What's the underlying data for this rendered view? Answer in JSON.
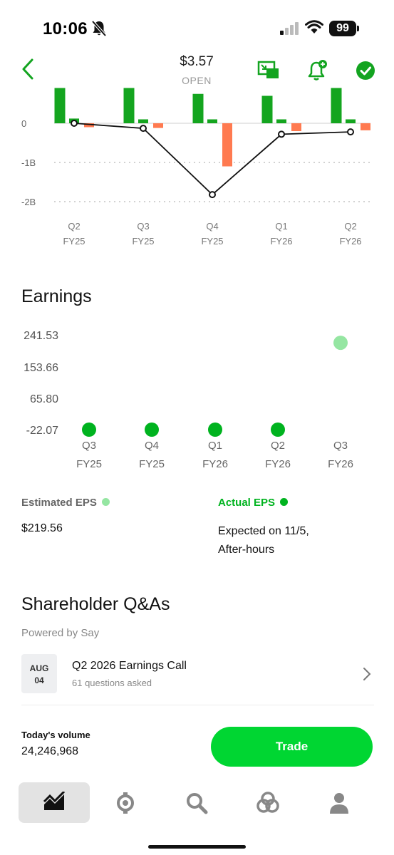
{
  "status_bar": {
    "time": "10:06",
    "battery": "99"
  },
  "header": {
    "price": "$3.57",
    "session": "OPEN",
    "icons": [
      "back-chevron-icon",
      "picture-in-picture-icon",
      "add-alert-bell-icon",
      "owned-check-icon"
    ]
  },
  "revenue_chart": {
    "y_labels": [
      "0",
      "-1B",
      "-2B"
    ],
    "quarters": [
      {
        "q": "Q2",
        "fy": "FY25"
      },
      {
        "q": "Q3",
        "fy": "FY25"
      },
      {
        "q": "Q4",
        "fy": "FY25"
      },
      {
        "q": "Q1",
        "fy": "FY26"
      },
      {
        "q": "Q2",
        "fy": "FY26"
      }
    ]
  },
  "chart_data": [
    {
      "type": "bar",
      "categories": [
        "Q2 FY25",
        "Q3 FY25",
        "Q4 FY25",
        "Q1 FY26",
        "Q2 FY26"
      ],
      "series": [
        {
          "values": [
            0.9,
            0.9,
            0.75,
            0.7,
            0.9
          ],
          "color": "#14a51f"
        },
        {
          "values": [
            0.12,
            0.1,
            0.1,
            0.1,
            0.1
          ],
          "color": "#14a51f"
        },
        {
          "values": [
            -0.1,
            -0.12,
            -1.1,
            -0.2,
            -0.18
          ],
          "color": "#ff7a50"
        }
      ],
      "line": {
        "values": [
          0.0,
          -0.13,
          -1.82,
          -0.28,
          -0.22
        ],
        "color": "#111111"
      },
      "ylim": [
        -2.1,
        0.9
      ],
      "y_ticks": [
        0,
        -1,
        -2
      ],
      "grid": true
    },
    {
      "type": "scatter",
      "title": "Earnings",
      "categories": [
        "Q3 FY25",
        "Q4 FY25",
        "Q1 FY26",
        "Q2 FY26",
        "Q3 FY26"
      ],
      "series": [
        {
          "name": "Actual EPS",
          "values": [
            -22.07,
            -22.07,
            -22.07,
            -22.07,
            null
          ],
          "color": "#00b31f"
        },
        {
          "name": "Estimated EPS",
          "values": [
            null,
            null,
            null,
            null,
            219.56
          ],
          "color": "#95e6a2"
        }
      ],
      "y_ticks": [
        -22.07,
        65.8,
        153.66,
        241.53
      ],
      "y_tick_labels": [
        "-22.07",
        "65.80",
        "153.66",
        "241.53"
      ],
      "grid": false
    }
  ],
  "earnings": {
    "title": "Earnings",
    "y_labels": [
      "241.53",
      "153.66",
      "65.80",
      "-22.07"
    ],
    "quarters": [
      {
        "q": "Q3",
        "fy": "FY25"
      },
      {
        "q": "Q4",
        "fy": "FY25"
      },
      {
        "q": "Q1",
        "fy": "FY26"
      },
      {
        "q": "Q2",
        "fy": "FY26"
      },
      {
        "q": "Q3",
        "fy": "FY26"
      }
    ],
    "estimated_label": "Estimated EPS",
    "estimated_value": "$219.56",
    "actual_label": "Actual EPS",
    "actual_line1": "Expected on 11/5,",
    "actual_line2": "After-hours",
    "colors": {
      "actual": "#00b31f",
      "estimated": "#95e6a2"
    }
  },
  "qa": {
    "title": "Shareholder Q&As",
    "powered_by": "Powered by Say",
    "item": {
      "month": "AUG",
      "day": "04",
      "title": "Q2 2026 Earnings Call",
      "subtitle": "61 questions asked"
    }
  },
  "footer": {
    "volume_label": "Today's volume",
    "volume_value": "24,246,968",
    "trade_label": "Trade",
    "accent": "#00d632"
  },
  "tabbar": {
    "tabs": [
      "portfolio-tab",
      "bitcoin-tab",
      "search-tab",
      "explore-tab",
      "profile-tab"
    ],
    "active": "portfolio-tab"
  }
}
